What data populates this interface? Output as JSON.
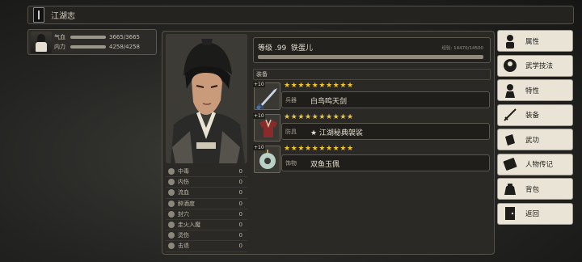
{
  "window": {
    "title": "江湖志"
  },
  "character": {
    "hp_label": "气血",
    "hp_value": "3665/3665",
    "hp_fraction": 1.0,
    "mp_label": "内力",
    "mp_value": "4258/4258",
    "mp_fraction": 1.0
  },
  "status": {
    "level_text": "等级 .99",
    "name": "铁蛋儿",
    "exp_text": "经验: 14470/14500",
    "exp_fraction": 0.998
  },
  "attributes": [
    {
      "name": "中毒",
      "value": "0"
    },
    {
      "name": "内伤",
      "value": "0"
    },
    {
      "name": "流血",
      "value": "0"
    },
    {
      "name": "醉酒度",
      "value": "0"
    },
    {
      "name": "封穴",
      "value": "0"
    },
    {
      "name": "走火入魔",
      "value": "0"
    },
    {
      "name": "烫伤",
      "value": "0"
    },
    {
      "name": "击退",
      "value": "0"
    }
  ],
  "equipment": {
    "header": "装备",
    "items": [
      {
        "level": "+10",
        "stars": "★★★★★★★★★★",
        "star_count": 10,
        "type": "兵器",
        "name": "白鸟鸣天剑",
        "icon": "sword-icon"
      },
      {
        "level": "+10",
        "stars": "★★★★★★★★★★",
        "star_count": 10,
        "type": "防具",
        "name": "★ 江湖秘典袈裟",
        "icon": "armor-icon"
      },
      {
        "level": "+10",
        "stars": "★★★★★★★★★★",
        "star_count": 10,
        "type": "饰物",
        "name": "双鱼玉佩",
        "icon": "jade-pendant-icon"
      }
    ]
  },
  "menu": [
    {
      "label": "属性",
      "icon": "person-icon"
    },
    {
      "label": "武学技法",
      "icon": "martial-arts-icon"
    },
    {
      "label": "特性",
      "icon": "trait-icon"
    },
    {
      "label": "装备",
      "icon": "sword-icon"
    },
    {
      "label": "武功",
      "icon": "scroll-icon"
    },
    {
      "label": "人物传记",
      "icon": "book-icon"
    },
    {
      "label": "背包",
      "icon": "bag-icon"
    },
    {
      "label": "返回",
      "icon": "exit-door-icon"
    }
  ],
  "colors": {
    "star": "#f0c526",
    "panel": "#2a2925",
    "button": "#e9e4d6"
  }
}
